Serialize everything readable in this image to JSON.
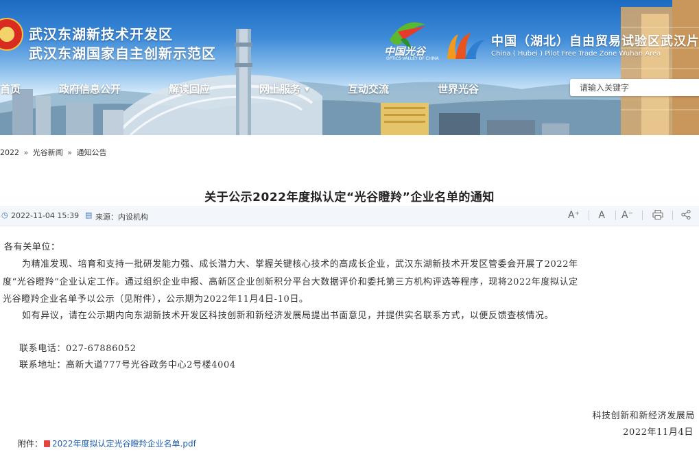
{
  "header": {
    "title_line1": "武汉东湖新技术开发区",
    "title_line2": "武汉东湖国家自主创新示范区",
    "ovc_logo_text": "中国光谷",
    "ovc_logo_en": "OPTICS VALLEY OF CHINA",
    "ftz_title": "中国（湖北）自由贸易试验区武汉片",
    "ftz_subtitle": "China ( Hubei ) Pilot Free Trade Zone Wuhan Area"
  },
  "nav": {
    "items": [
      "首页",
      "政府信息公开",
      "解读回应",
      "网上服务",
      "互动交流",
      "世界光谷"
    ]
  },
  "search": {
    "placeholder": "请输入关键字"
  },
  "breadcrumb": {
    "items": [
      "2022",
      "光谷新闻",
      "通知公告"
    ],
    "separator": "»"
  },
  "article": {
    "title": "关于公示2022年度拟认定“光谷瞪羚”企业名单的通知",
    "date": "2022-11-04 15:39",
    "source": "来源：内设机构",
    "tools": [
      "A⁺",
      "A",
      "A⁻",
      "print-icon",
      "share-icon"
    ],
    "greeting": "各有关单位：",
    "para1_line1": "为精准发现、培育和支持一批研发能力强、成长潜力大、掌握关键核心技术的高成长企业，武汉东湖新技术开发区管委会开展了2022年",
    "para1_line2": "度“光谷瞪羚”企业认定工作。通过组织企业申报、高新区企业创新积分平台大数据评价和委托第三方机构评选等程序，现将2022年度拟认定",
    "para1_line3": "光谷瞪羚企业名单予以公示（见附件），公示期为2022年11月4日-10日。",
    "para2": "如有异议，请在公示期内向东湖新技术开发区科技创新和新经济发展局提出书面意见，并提供实名联系方式，以便反馈查核情况。",
    "phone": "联系电话：027-67886052",
    "address": "联系地址：高新大道777号光谷政务中心2号楼4004",
    "signature": "科技创新和新经济发展局",
    "sign_date": "2022年11月4日",
    "attachment_label": "附件：",
    "attachment_file": "2022年度拟认定光谷瞪羚企业名单.pdf"
  },
  "colors": {
    "banner_sky": "#1c6bc2",
    "link": "#1f5fb0",
    "meta_bar": "#f3f6fa",
    "pdf_icon": "#e0463e"
  }
}
